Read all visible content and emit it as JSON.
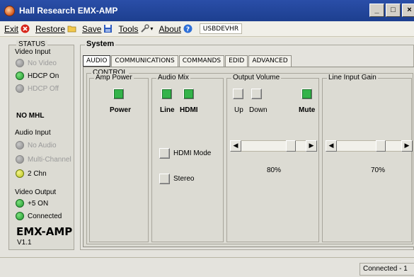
{
  "window": {
    "title": "Hall Research EMX-AMP",
    "buttons": {
      "minimize": "_",
      "maximize": "□",
      "close": "×"
    }
  },
  "menu": {
    "exit": "Exit",
    "restore": "Restore",
    "save": "Save",
    "tools": "Tools",
    "about": "About",
    "device_id": "USBDEVHR"
  },
  "status": {
    "title": "STATUS",
    "video_input_label": "Video Input",
    "video_input": [
      {
        "label": "No Video",
        "state": "off"
      },
      {
        "label": "HDCP On",
        "state": "green"
      },
      {
        "label": "HDCP Off",
        "state": "off"
      }
    ],
    "no_mhl": "NO MHL",
    "audio_input_label": "Audio Input",
    "audio_input": [
      {
        "label": "No Audio",
        "state": "off"
      },
      {
        "label": "Multi-Channel",
        "state": "off"
      },
      {
        "label": "2 Chn",
        "state": "yellow"
      }
    ],
    "video_output_label": "Video Output",
    "video_output": [
      {
        "label": "+5 ON",
        "state": "green"
      },
      {
        "label": "Connected",
        "state": "green"
      }
    ],
    "brand": "EMX-AMP",
    "version": "V1.1"
  },
  "system": {
    "title": "System",
    "tabs": [
      "AUDIO",
      "COMMUNICATIONS",
      "COMMANDS",
      "EDID",
      "ADVANCED"
    ],
    "active_tab": "AUDIO",
    "control_title": "CONTROL",
    "amp_power": {
      "title": "Amp Power",
      "power_label": "Power",
      "power_on": true
    },
    "audio_mix": {
      "title": "Audio Mix",
      "line_label": "Line",
      "hdmi_label": "HDMI",
      "hdmi_mode_label": "HDMI Mode",
      "stereo_label": "Stereo",
      "line_on": true,
      "hdmi_on": true
    },
    "output_volume": {
      "title": "Output Volume",
      "up_label": "Up",
      "down_label": "Down",
      "mute_label": "Mute",
      "mute_on": true,
      "value": 0.8,
      "display": "80%"
    },
    "line_input_gain": {
      "title": "Line Input Gain",
      "value": 0.7,
      "display": "70%"
    }
  },
  "statusbar": {
    "connection": "Connected - 1"
  },
  "colors": {
    "titlebar": "#1d3f8f",
    "active_green": "#34b34a",
    "yellow_led": "#b9c11a"
  }
}
